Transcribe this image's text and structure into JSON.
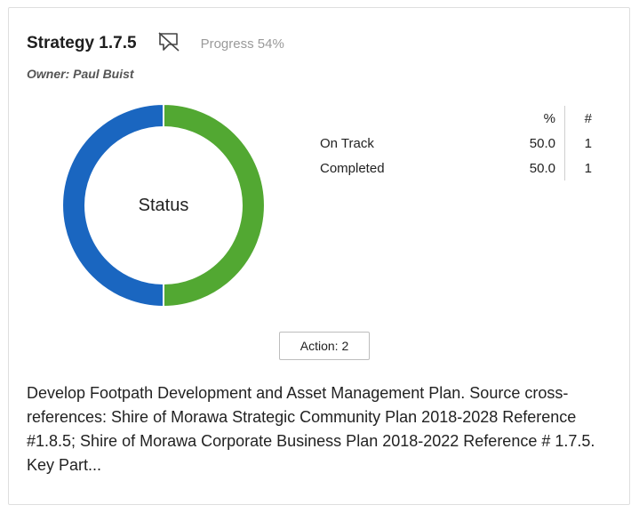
{
  "strategy": {
    "title": "Strategy 1.7.5",
    "progress_text": "Progress 54%",
    "progress_value": 54,
    "owner_text": "Owner: Paul Buist"
  },
  "icons": {
    "comment": "comment-off-icon"
  },
  "chart_data": {
    "type": "pie",
    "center_label": "Status",
    "slices": [
      {
        "label": "On Track",
        "percent": 50.0,
        "count": 1,
        "color": "#52a832"
      },
      {
        "label": "Completed",
        "percent": 50.0,
        "count": 1,
        "color": "#1a66c0"
      }
    ]
  },
  "stats": {
    "header_pct": "%",
    "header_count": "#",
    "rows": [
      {
        "label": "On Track",
        "pct": "50.0",
        "count": "1"
      },
      {
        "label": "Completed",
        "pct": "50.0",
        "count": "1"
      }
    ]
  },
  "action_button": {
    "label": "Action: 2"
  },
  "description": "Develop Footpath Development and Asset Management Plan. Source cross-references: Shire of Morawa Strategic Community Plan 2018-2028 Reference #1.8.5; Shire of Morawa Corporate Business Plan 2018-2022 Reference # 1.7.5. Key Part..."
}
